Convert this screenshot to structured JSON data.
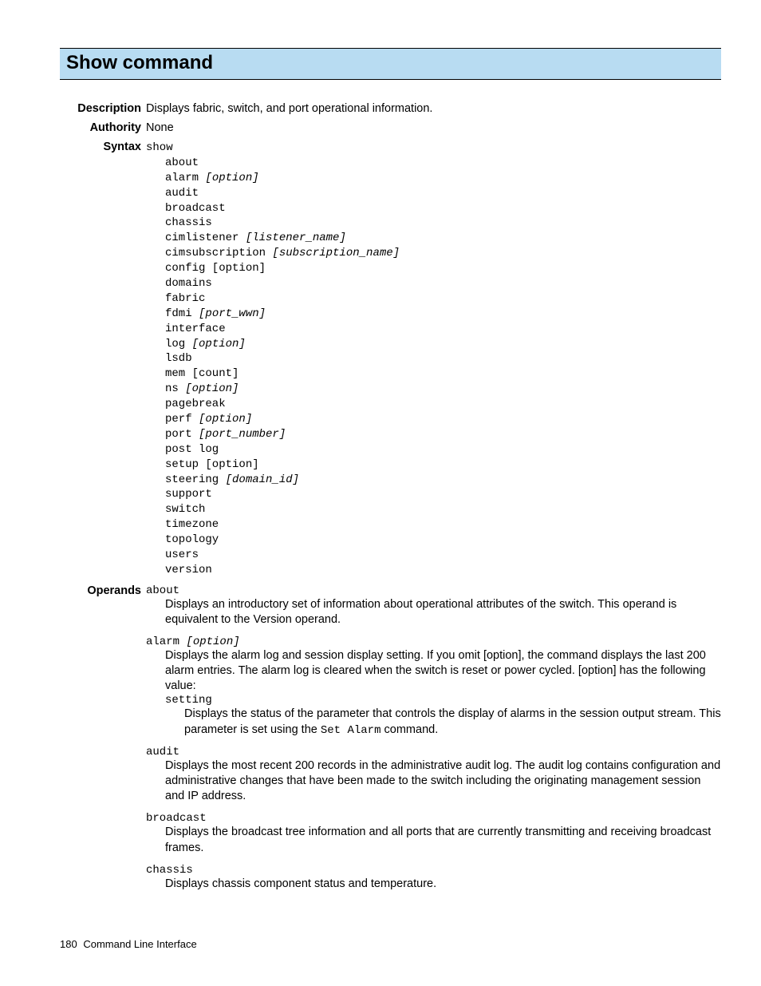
{
  "title": "Show command",
  "sections": {
    "description": {
      "label": "Description",
      "text": "Displays fabric, switch, and port operational information."
    },
    "authority": {
      "label": "Authority",
      "text": "None"
    },
    "syntax": {
      "label": "Syntax",
      "command": "show",
      "items": [
        {
          "text": "about"
        },
        {
          "text": "alarm ",
          "arg": "[option]"
        },
        {
          "text": "audit"
        },
        {
          "text": "broadcast"
        },
        {
          "text": "chassis"
        },
        {
          "text": "cimlistener ",
          "arg": "[listener_name]"
        },
        {
          "text": "cimsubscription ",
          "arg": "[subscription_name]"
        },
        {
          "text": "config [option]"
        },
        {
          "text": "domains"
        },
        {
          "text": "fabric"
        },
        {
          "text": "fdmi ",
          "arg": "[port_wwn]"
        },
        {
          "text": "interface"
        },
        {
          "text": "log ",
          "arg": "[option]"
        },
        {
          "text": "lsdb"
        },
        {
          "text": "mem [count]"
        },
        {
          "text": "ns ",
          "arg": "[option]"
        },
        {
          "text": "pagebreak"
        },
        {
          "text": "perf ",
          "arg": "[option]"
        },
        {
          "text": "port ",
          "arg": "[port_number]"
        },
        {
          "text": "post log"
        },
        {
          "text": "setup [option]"
        },
        {
          "text": "steering ",
          "arg": "[domain_id]"
        },
        {
          "text": "support"
        },
        {
          "text": "switch"
        },
        {
          "text": "timezone"
        },
        {
          "text": "topology"
        },
        {
          "text": "users"
        },
        {
          "text": "version"
        }
      ]
    },
    "operands": {
      "label": "Operands",
      "items": [
        {
          "name": "about",
          "desc": "Displays an introductory set of information about operational attributes of the switch. This operand is equivalent to the Version operand."
        },
        {
          "name": "alarm ",
          "name_arg": "[option]",
          "desc": "Displays the alarm log and session display setting. If you omit [option], the command displays the last 200 alarm entries. The alarm log is cleared when the switch is reset or power cycled. [option] has the following value:",
          "sub": {
            "name": "setting",
            "desc_pre": "Displays the status of the parameter that controls the display of alarms in the session output stream. This parameter is set using the ",
            "desc_code": "Set Alarm",
            "desc_post": " command."
          }
        },
        {
          "name": "audit",
          "desc": "Displays the most recent 200 records in the administrative audit log. The audit log contains configuration and administrative changes that have been made to the switch including the originating management session and IP address."
        },
        {
          "name": "broadcast",
          "desc": "Displays the broadcast tree information and all ports that are currently transmitting and receiving broadcast frames."
        },
        {
          "name": "chassis",
          "desc": "Displays chassis component status and temperature."
        }
      ]
    }
  },
  "footer": {
    "page": "180",
    "section": "Command Line Interface"
  }
}
